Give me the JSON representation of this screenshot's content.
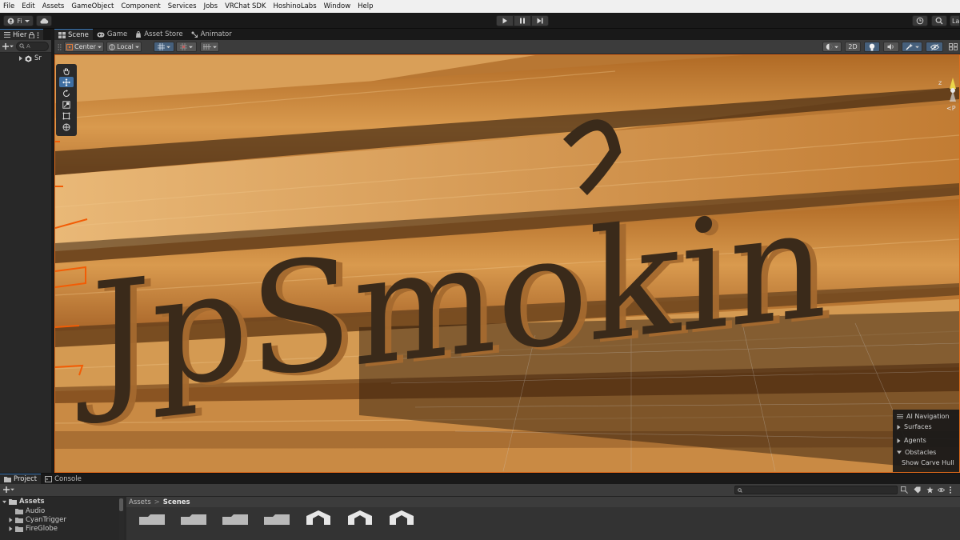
{
  "menubar": {
    "items": [
      "File",
      "Edit",
      "Assets",
      "GameObject",
      "Component",
      "Services",
      "Jobs",
      "VRChat SDK",
      "HoshinoLabs",
      "Window",
      "Help"
    ]
  },
  "toolbar": {
    "account_label": "Fi",
    "layers_label": "La"
  },
  "hierarchy": {
    "tab_label": "Hier",
    "search_hint": "A",
    "scene_item": "Sr"
  },
  "scene_tabs": [
    {
      "label": "Scene",
      "icon": "grid-icon"
    },
    {
      "label": "Game",
      "icon": "gamepad-icon"
    },
    {
      "label": "Asset Store",
      "icon": "store-icon"
    },
    {
      "label": "Animator",
      "icon": "animator-icon"
    }
  ],
  "scene_toolbar": {
    "pivot_mode": "Center",
    "pivot_rotation": "Local",
    "mode_2d": "2D"
  },
  "scene_view": {
    "sign_text": "JpSmokin",
    "gizmo_axis": "z",
    "gizmo_persp": "<P"
  },
  "ai_navigation": {
    "title": "AI Navigation",
    "items": [
      "Surfaces",
      "Agents",
      "Obstacles"
    ],
    "option": "Show Carve Hull"
  },
  "project": {
    "tabs": [
      "Project",
      "Console"
    ],
    "breadcrumb": [
      "Assets",
      "Scenes"
    ],
    "tree_root": "Assets",
    "tree_items": [
      "Audio",
      "CyanTrigger",
      "FireGlobe"
    ]
  }
}
